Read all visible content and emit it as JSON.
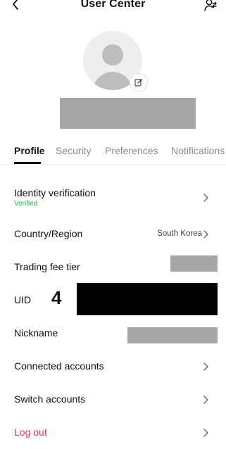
{
  "header": {
    "title": "User Center",
    "back_icon": "chevron-left-icon",
    "right_icon": "user-switch-icon"
  },
  "profile": {
    "avatar_icon": "user-avatar-icon",
    "edit_icon": "edit-icon"
  },
  "tabs": [
    {
      "label": "Profile",
      "active": true
    },
    {
      "label": "Security",
      "active": false
    },
    {
      "label": "Preferences",
      "active": false
    },
    {
      "label": "Notifications",
      "active": false
    }
  ],
  "rows": {
    "identity": {
      "label": "Identity verification",
      "status": "Verified"
    },
    "country": {
      "label": "Country/Region",
      "value": "South Korea"
    },
    "fee": {
      "label": "Trading fee tier"
    },
    "uid": {
      "label": "UID",
      "overlay": "4"
    },
    "nickname": {
      "label": "Nickname"
    },
    "connected": {
      "label": "Connected accounts"
    },
    "switch": {
      "label": "Switch accounts"
    },
    "logout": {
      "label": "Log out"
    }
  },
  "colors": {
    "verified": "#27a84a",
    "logout": "#e0305c",
    "redact_gray": "#a6a6a6",
    "redact_black": "#000000"
  }
}
